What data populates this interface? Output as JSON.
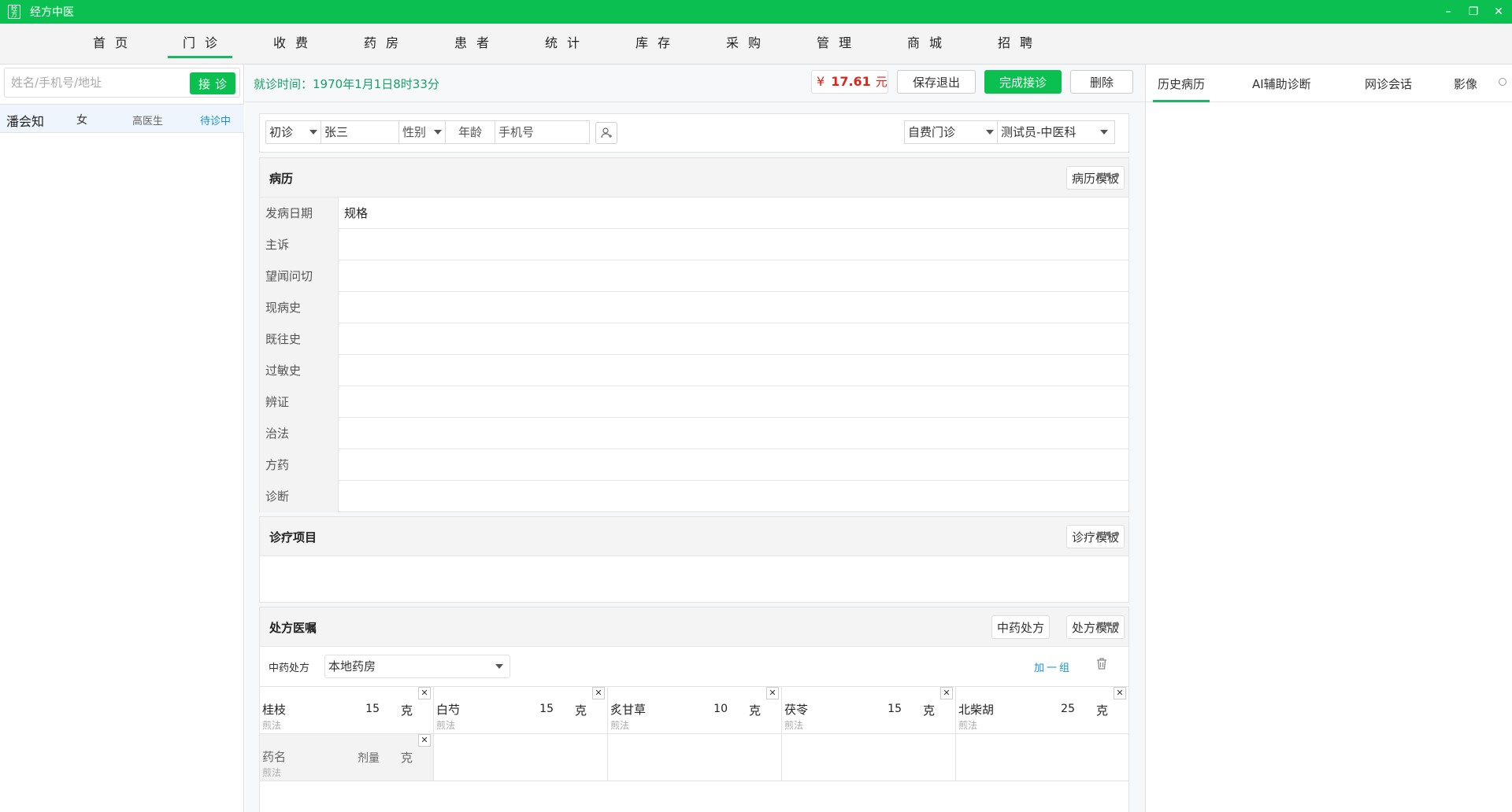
{
  "window": {
    "title": "经方中医",
    "logo_text": "经方",
    "controls": {
      "minimize": "–",
      "restore": "❐",
      "close": "✕"
    }
  },
  "menu": {
    "items": [
      {
        "label": "首页",
        "active": false
      },
      {
        "label": "门诊",
        "active": true
      },
      {
        "label": "收费",
        "active": false
      },
      {
        "label": "药房",
        "active": false
      },
      {
        "label": "患者",
        "active": false
      },
      {
        "label": "统计",
        "active": false
      },
      {
        "label": "库存",
        "active": false
      },
      {
        "label": "采购",
        "active": false
      },
      {
        "label": "管理",
        "active": false
      },
      {
        "label": "商城",
        "active": false
      },
      {
        "label": "招聘",
        "active": false
      }
    ]
  },
  "left": {
    "search_placeholder": "姓名/手机号/地址",
    "receive_button": "接诊",
    "patients": [
      {
        "name": "潘会知",
        "gender": "女",
        "doctor": "高医生",
        "status": "待诊中"
      }
    ]
  },
  "topbar": {
    "visit_time": "就诊时间：1970年1月1日8时33分",
    "price_symbol": "¥",
    "price_value": "17.61",
    "price_unit": "元",
    "save_exit": "保存退出",
    "finish": "完成接诊",
    "delete": "删除"
  },
  "patient_info": {
    "visit_type": "初诊",
    "name": "张三",
    "gender_placeholder": "性别",
    "age_placeholder": "年龄",
    "phone_placeholder": "手机号",
    "clinic_type": "自费门诊",
    "doctor_dept": "测试员-中医科"
  },
  "record": {
    "title": "病历",
    "template_button": "病历模板",
    "more": "•••",
    "fields": [
      {
        "label": "发病日期",
        "value": "规格"
      },
      {
        "label": "主诉",
        "value": ""
      },
      {
        "label": "望闻问切",
        "value": ""
      },
      {
        "label": "现病史",
        "value": ""
      },
      {
        "label": "既往史",
        "value": ""
      },
      {
        "label": "过敏史",
        "value": ""
      },
      {
        "label": "辨证",
        "value": ""
      },
      {
        "label": "治法",
        "value": ""
      },
      {
        "label": "方药",
        "value": ""
      },
      {
        "label": "诊断",
        "value": ""
      }
    ]
  },
  "treatment": {
    "title": "诊疗项目",
    "template_button": "诊疗模板",
    "more": "•••"
  },
  "prescription": {
    "title": "处方医嘱",
    "tcm_button": "中药处方",
    "template_button": "处方模版",
    "more": "•••",
    "type_label": "中药处方",
    "pharmacy": "本地药房",
    "add_group": "加一组",
    "herbs": [
      {
        "name": "桂枝",
        "dose": "15",
        "unit": "克",
        "method": "煎法"
      },
      {
        "name": "白芍",
        "dose": "15",
        "unit": "克",
        "method": "煎法"
      },
      {
        "name": "炙甘草",
        "dose": "10",
        "unit": "克",
        "method": "煎法"
      },
      {
        "name": "茯苓",
        "dose": "15",
        "unit": "克",
        "method": "煎法"
      },
      {
        "name": "北柴胡",
        "dose": "25",
        "unit": "克",
        "method": "煎法"
      }
    ],
    "new_herb": {
      "name": "药名",
      "dose": "剂量",
      "unit": "克",
      "method": "煎法"
    }
  },
  "right": {
    "tabs": [
      {
        "label": "历史病历",
        "active": true
      },
      {
        "label": "AI辅助诊断",
        "active": false
      },
      {
        "label": "网诊会话",
        "active": false
      },
      {
        "label": "影像",
        "active": false
      }
    ]
  },
  "colors": {
    "accent": "#0bbf50",
    "price": "#e0241c",
    "link": "#1a8fd8",
    "visit_time": "#17a06a"
  }
}
